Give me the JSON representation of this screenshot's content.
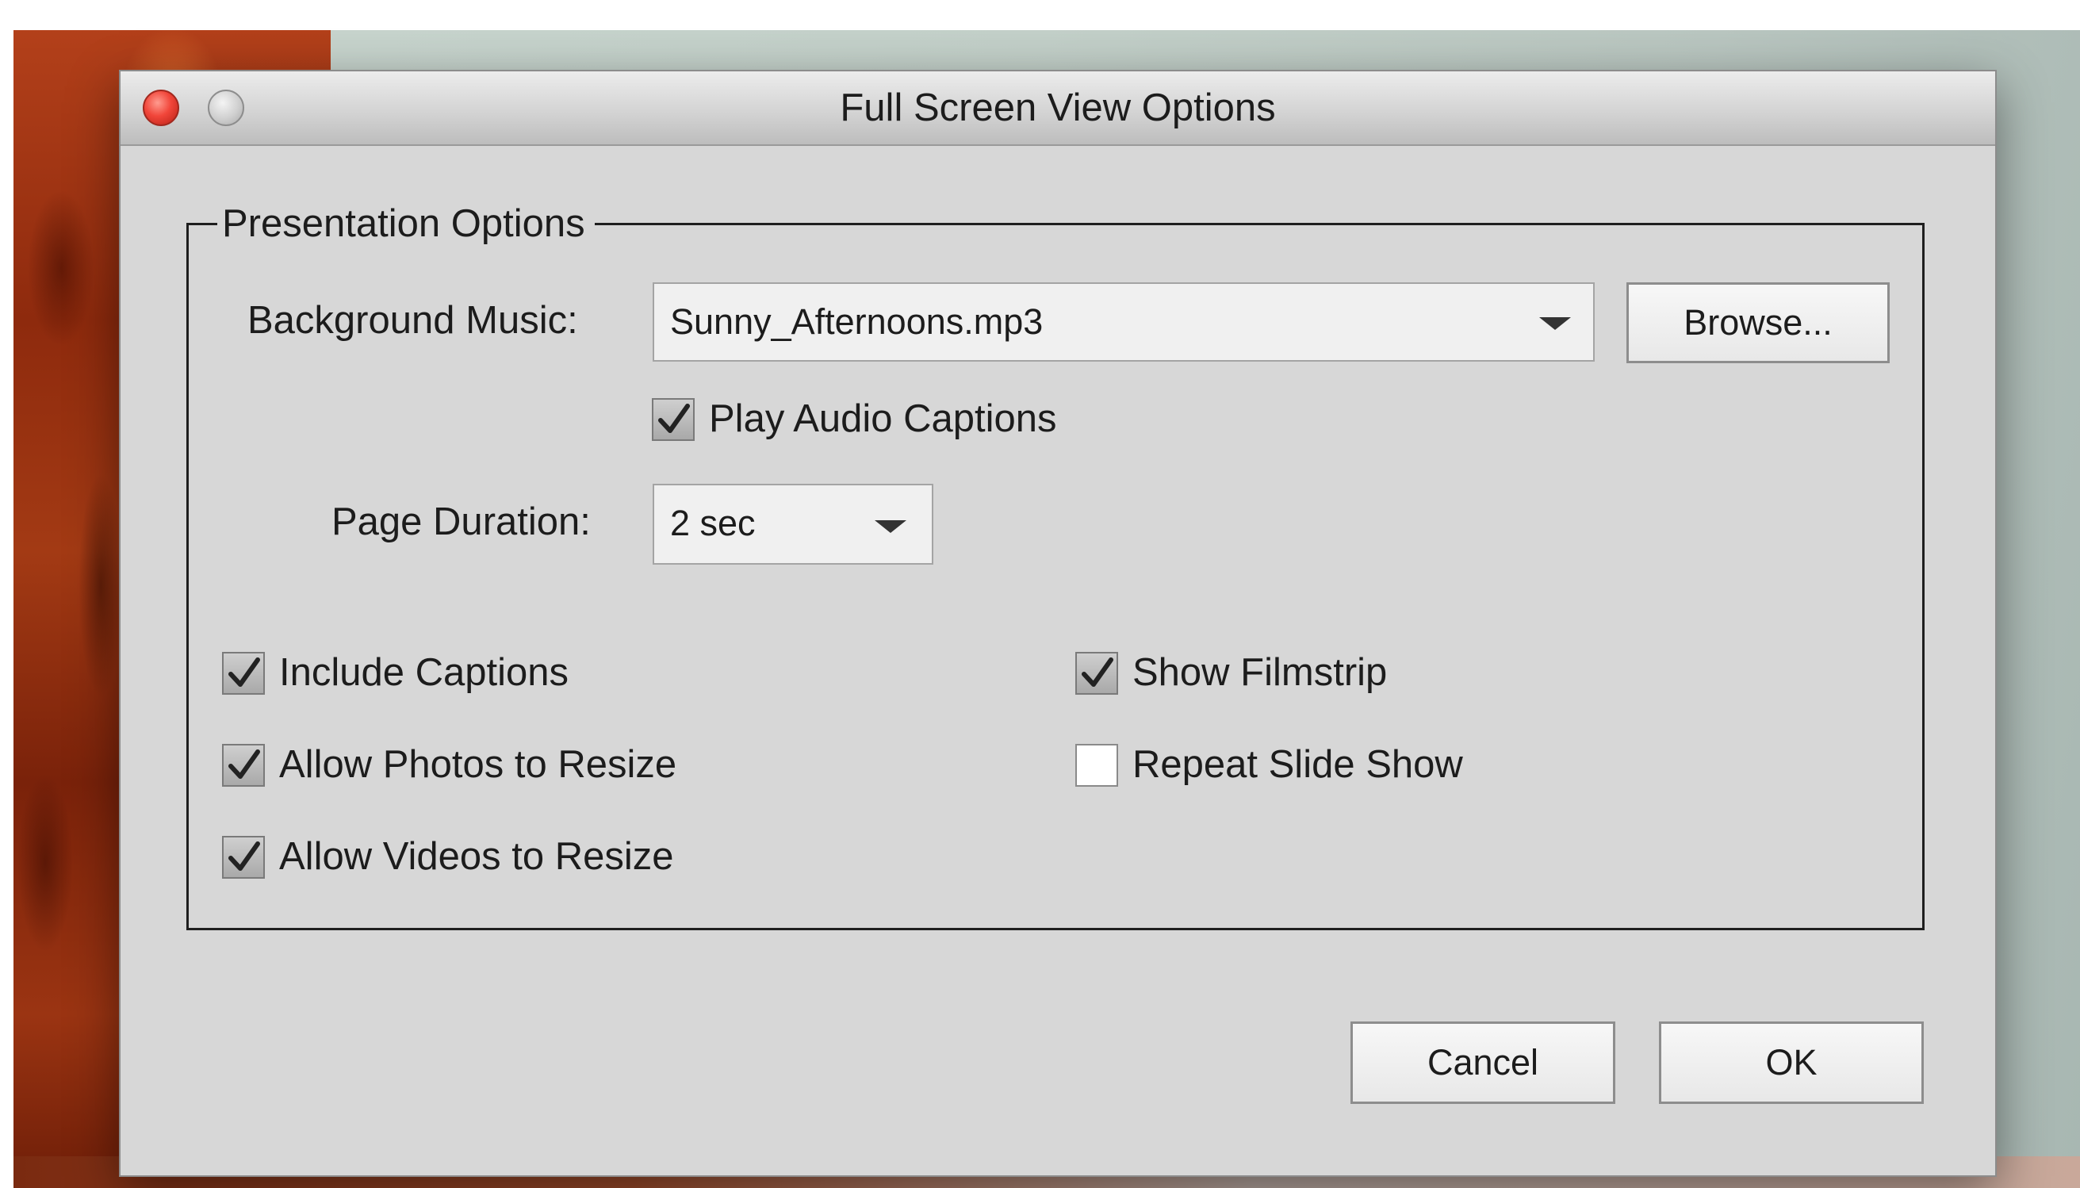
{
  "window": {
    "title": "Full Screen View Options"
  },
  "presentation": {
    "group_label": "Presentation Options",
    "background_music_label": "Background Music:",
    "background_music_value": "Sunny_Afternoons.mp3",
    "browse_label": "Browse...",
    "play_audio_captions_label": "Play Audio Captions",
    "play_audio_captions_checked": true,
    "page_duration_label": "Page Duration:",
    "page_duration_value": "2 sec"
  },
  "options": {
    "include_captions": {
      "label": "Include Captions",
      "checked": true
    },
    "allow_photos_resize": {
      "label": "Allow Photos to Resize",
      "checked": true
    },
    "allow_videos_resize": {
      "label": "Allow Videos to Resize",
      "checked": true
    },
    "show_filmstrip": {
      "label": "Show Filmstrip",
      "checked": true
    },
    "repeat_slide_show": {
      "label": "Repeat Slide Show",
      "checked": false
    }
  },
  "buttons": {
    "cancel_label": "Cancel",
    "ok_label": "OK"
  },
  "colors": {
    "dialog_background": "#d7d7d7",
    "close_button": "#f1463a"
  },
  "icons": {
    "close": "close-icon",
    "minimize": "minimize-icon",
    "dropdown": "chevron-down-icon",
    "check": "checkmark-icon"
  }
}
